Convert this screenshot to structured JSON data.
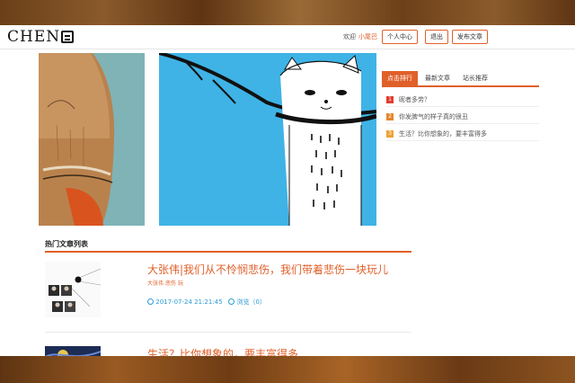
{
  "header": {
    "logo_text": "CHEN",
    "welcome": "欢迎",
    "username": "小尾巴",
    "buttons": [
      "个人中心",
      "退出",
      "发布文章"
    ]
  },
  "tabs": [
    "点击排行",
    "最新文章",
    "站长推荐"
  ],
  "hot_list": [
    {
      "rank": "1",
      "title": "昵者多劳？",
      "color": "#e23c2c"
    },
    {
      "rank": "2",
      "title": "你发脾气的样子真的很丑",
      "color": "#e5862b"
    },
    {
      "rank": "3",
      "title": "生活？比你想象的，要丰富得多",
      "color": "#eea234"
    }
  ],
  "section_title": "热门文章列表",
  "articles": [
    {
      "title": "大张伟|我们从不怜悯悲伤，我们带着悲伤一块玩儿",
      "tags": "大张伟 悲伤 玩",
      "date": "2017-07-24 21:21:45",
      "views_label": "浏览（",
      "views": "0",
      "views_close": "）"
    },
    {
      "title": "生活？比你想象的，要丰富得多"
    }
  ],
  "colors": {
    "accent": "#e0602a",
    "meta_blue": "#2a9bd6"
  }
}
